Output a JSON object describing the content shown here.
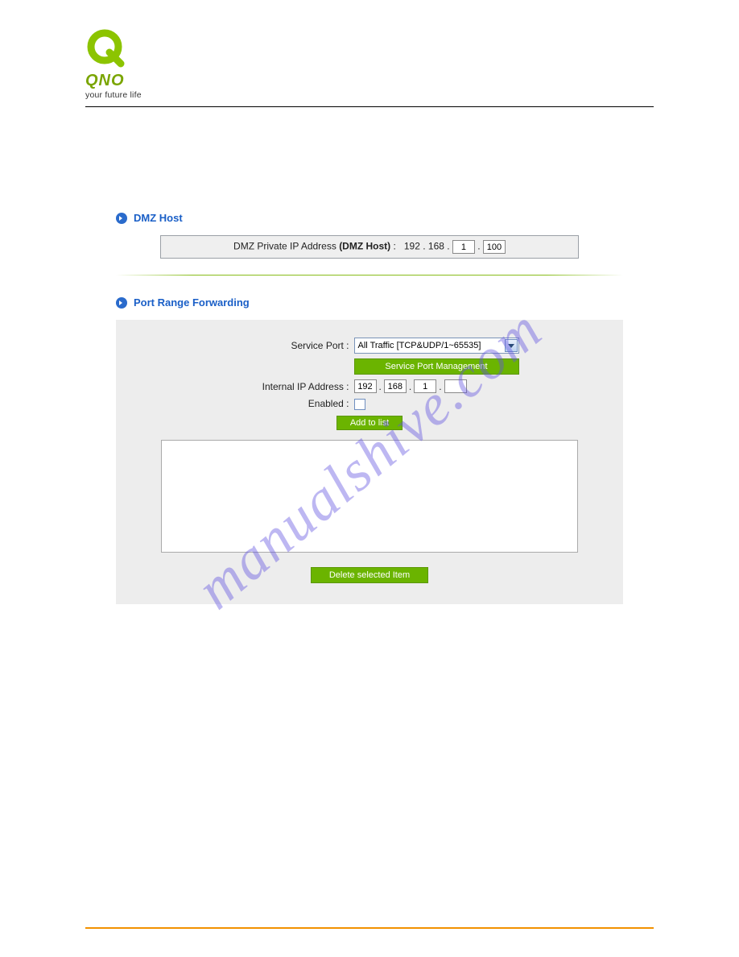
{
  "logo": {
    "brand": "QNO",
    "tagline": "your future life"
  },
  "watermark": "manualshive.com",
  "dmz": {
    "heading": "DMZ Host",
    "label_prefix": "DMZ Private IP Address ",
    "label_bold": "(DMZ Host)",
    "label_suffix": " :",
    "octet1": "192",
    "octet2": "168",
    "octet3": "1",
    "octet4": "100"
  },
  "pfw": {
    "heading": "Port Range Forwarding",
    "service_port_label": "Service Port :",
    "service_port_value": "All Traffic [TCP&UDP/1~65535]",
    "service_mgmt_btn": "Service Port Management",
    "internal_ip_label": "Internal IP Address :",
    "ip1": "192",
    "ip2": "168",
    "ip3": "1",
    "ip4": "",
    "enabled_label": "Enabled :",
    "add_btn": "Add to list",
    "delete_btn": "Delete selected Item"
  }
}
